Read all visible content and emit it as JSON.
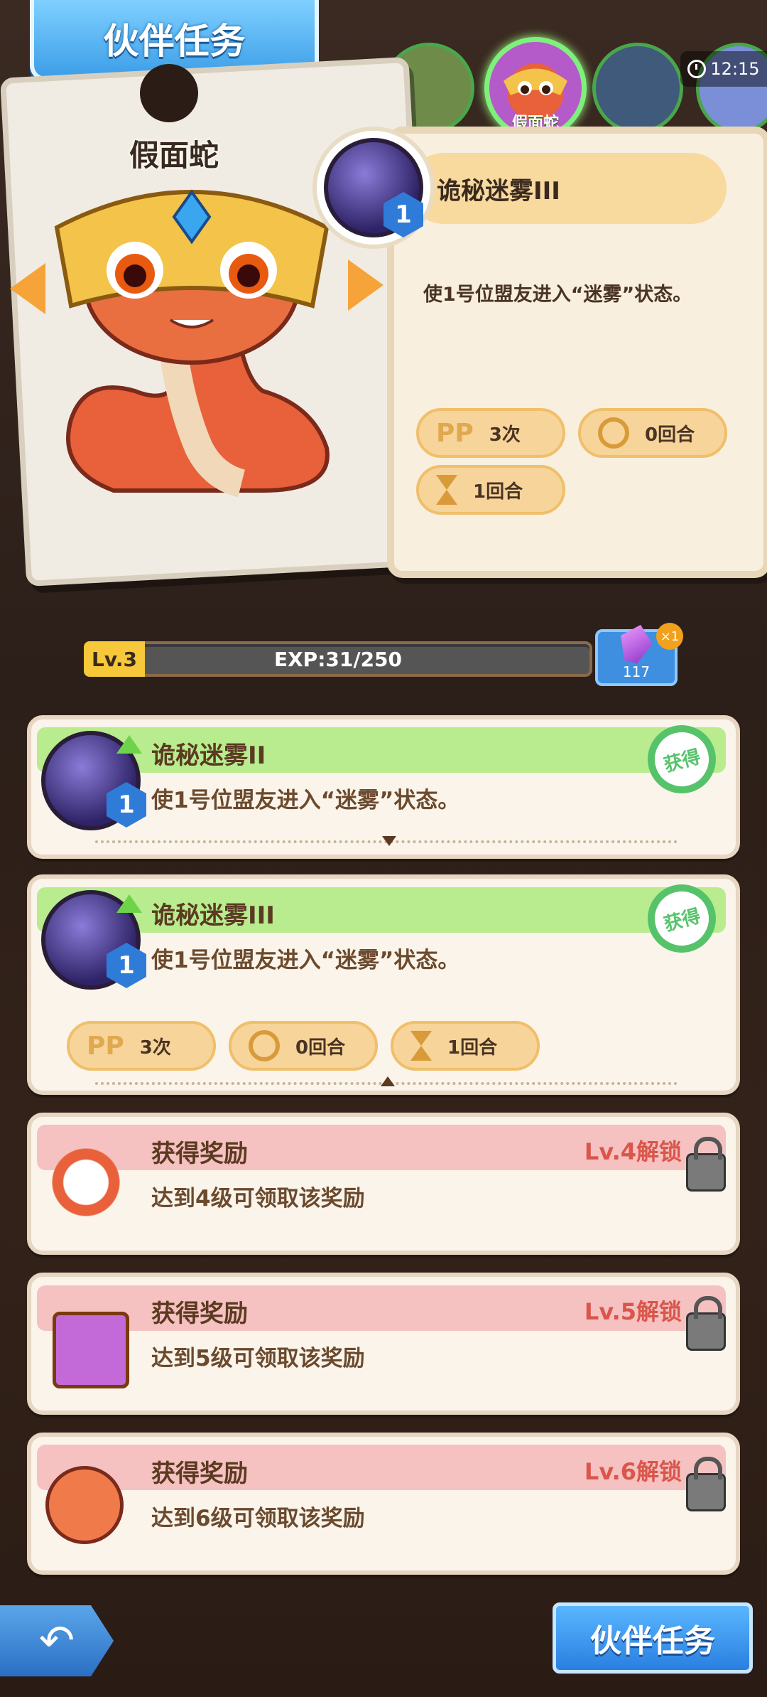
{
  "header": {
    "title": "伙伴任务",
    "time": "12:15"
  },
  "tabs": {
    "selected_label": "假面蛇"
  },
  "pet": {
    "name": "假面蛇"
  },
  "skill_detail": {
    "name": "诡秘迷雾III",
    "level": "1",
    "description": "使1号位盟友进入“迷雾”状态。",
    "pp_label": "PP",
    "pp_value": "3次",
    "cooldown_value": "0回合",
    "duration_value": "1回合"
  },
  "exp": {
    "level_label": "Lv.3",
    "text": "EXP:31/250"
  },
  "gem": {
    "count": "117",
    "multiplier": "×1"
  },
  "list": {
    "item1": {
      "title": "诡秘迷雾II",
      "level": "1",
      "desc": "使1号位盟友进入“迷雾”状态。",
      "badge": "获得"
    },
    "item2": {
      "title": "诡秘迷雾III",
      "level": "1",
      "desc": "使1号位盟友进入“迷雾”状态。",
      "badge": "获得",
      "pp_label": "PP",
      "pp_value": "3次",
      "cooldown_value": "0回合",
      "duration_value": "1回合"
    },
    "reward4": {
      "title": "获得奖励",
      "desc": "达到4级可领取该奖励",
      "unlock": "Lv.4解锁"
    },
    "reward5": {
      "title": "获得奖励",
      "desc": "达到5级可领取该奖励",
      "unlock": "Lv.5解锁"
    },
    "reward6": {
      "title": "获得奖励",
      "desc": "达到6级可领取该奖励",
      "unlock": "Lv.6解锁"
    }
  },
  "footer": {
    "task_button": "伙伴任务"
  },
  "colors": {
    "accent_blue": "#3d9ee8",
    "green_strip": "#b8ec8e",
    "pink_strip": "#f6c1c1",
    "unlock_red": "#d9564a"
  }
}
